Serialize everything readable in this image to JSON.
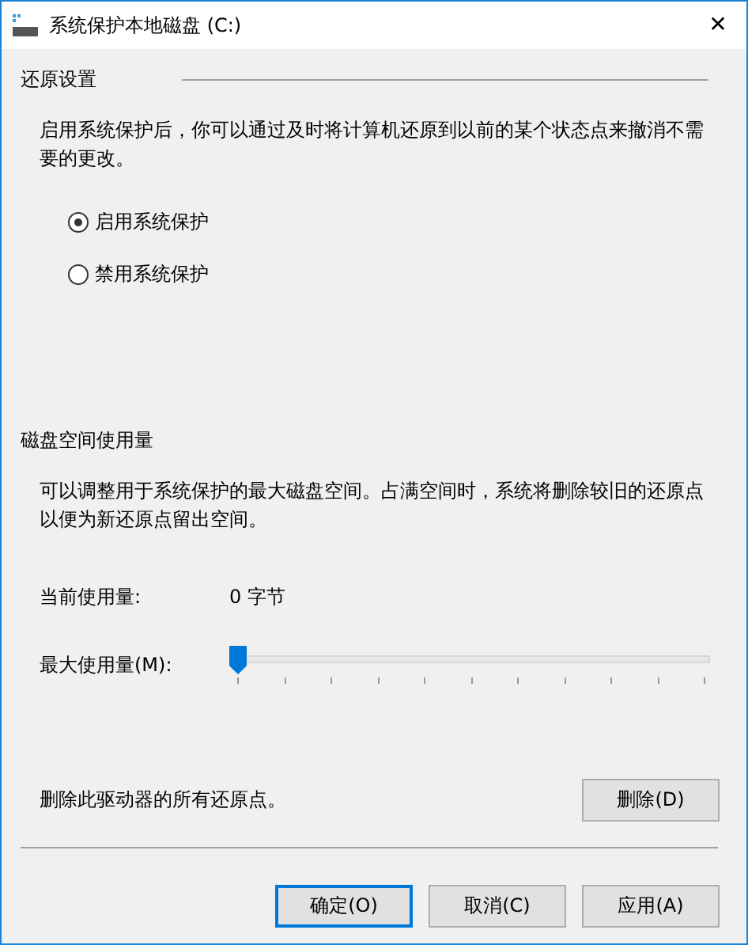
{
  "window": {
    "title": "系统保护本地磁盘 (C:)",
    "close": "✕"
  },
  "restore": {
    "heading": "还原设置",
    "description": "启用系统保护后，你可以通过及时将计算机还原到以前的某个状态点来撤消不需要的更改。",
    "options": [
      {
        "label": "启用系统保护",
        "selected": true
      },
      {
        "label": "禁用系统保护",
        "selected": false
      }
    ]
  },
  "disk": {
    "heading": "磁盘空间使用量",
    "description": "可以调整用于系统保护的最大磁盘空间。占满空间时，系统将删除较旧的还原点以便为新还原点留出空间。",
    "current_label": "当前使用量:",
    "current_value": "0 字节",
    "max_label": "最大使用量(M):",
    "max_slider": {
      "level": 0
    }
  },
  "delete": {
    "text": "删除此驱动器的所有还原点。",
    "button": "删除(D)"
  },
  "buttons": [
    {
      "label": "确定(O)",
      "default": true
    },
    {
      "label": "取消(C)",
      "default": false
    },
    {
      "label": "应用(A)",
      "default": false
    }
  ]
}
